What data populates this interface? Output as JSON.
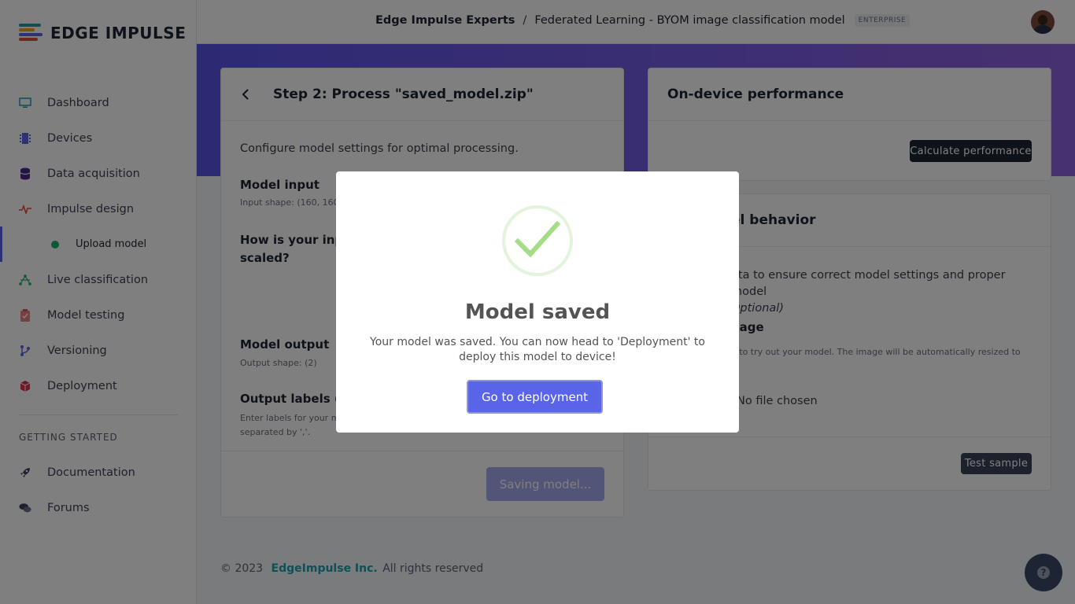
{
  "app": {
    "logo_text": "EDGE IMPULSE",
    "logo_colors": [
      "#e04b3a",
      "#f5a623",
      "#1f9fb0",
      "#5a64e8"
    ]
  },
  "sidebar": {
    "items": [
      {
        "label": "Dashboard",
        "icon": "monitor-icon"
      },
      {
        "label": "Devices",
        "icon": "chip-icon"
      },
      {
        "label": "Data acquisition",
        "icon": "database-icon"
      },
      {
        "label": "Impulse design",
        "icon": "pulse-icon"
      }
    ],
    "sub_item": {
      "label": "Upload model",
      "status_color": "#1fae6b"
    },
    "items_after": [
      {
        "label": "Live classification",
        "icon": "network-icon"
      },
      {
        "label": "Model testing",
        "icon": "clipboard-check-icon"
      },
      {
        "label": "Versioning",
        "icon": "branch-icon"
      },
      {
        "label": "Deployment",
        "icon": "box-icon"
      }
    ],
    "section_title": "GETTING STARTED",
    "getting_started": [
      {
        "label": "Documentation",
        "icon": "rocket-icon"
      },
      {
        "label": "Forums",
        "icon": "chat-icon"
      }
    ]
  },
  "header": {
    "project_owner": "Edge Impulse Experts",
    "separator": "/",
    "project_name": "Federated Learning - BYOM image classification model",
    "badge": "ENTERPRISE"
  },
  "left_card": {
    "title": "Step 2: Process \"saved_model.zip\"",
    "intro": "Configure model settings for optimal processing.",
    "model_input_label": "Model input",
    "model_input_shape": "Input shape: (160, 160",
    "scaling_question_line1": "How is your input",
    "scaling_question_line2": "scaled?",
    "model_output_label": "Model output",
    "model_output_shape": "Output shape: (2)",
    "output_labels_label": "Output labels (2)",
    "output_labels_help_line1": "Enter labels for your m",
    "output_labels_help_line2": "separated by ','.",
    "saving_button": "Saving model..."
  },
  "perf_card": {
    "title": "On-device performance",
    "calc_button": "Calculate performance"
  },
  "behavior_card": {
    "title": "el behavior",
    "text_line1": "ata to ensure correct model settings and proper model",
    "text_line2": "Optional)",
    "image_label": "nage",
    "image_help": "e to try out your model. The image will be automatically resized to",
    "file_status": "No file chosen",
    "test_button": "Test sample"
  },
  "modal": {
    "title": "Model saved",
    "message": "Your model was saved. You can now head to 'Deployment' to deploy this model to device!",
    "button": "Go to deployment"
  },
  "footer": {
    "copyright": "© 2023",
    "company": "EdgeImpulse Inc.",
    "rights": "All rights reserved"
  },
  "help": {
    "icon": "question-icon",
    "glyph": "?"
  }
}
